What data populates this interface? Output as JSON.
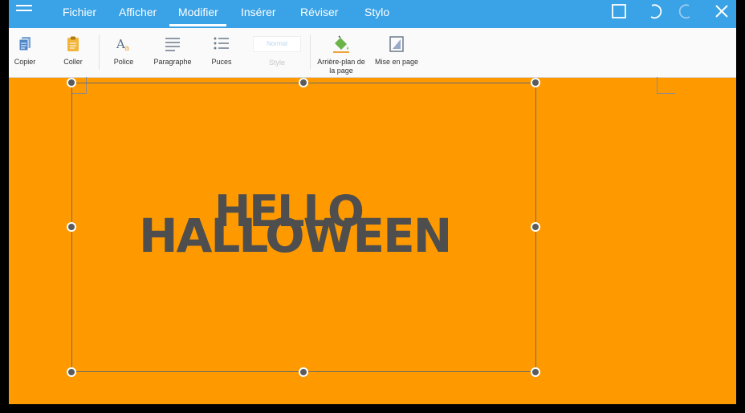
{
  "menu": {
    "tabs": [
      {
        "label": "Fichier"
      },
      {
        "label": "Afficher"
      },
      {
        "label": "Modifier",
        "active": true
      },
      {
        "label": "Insérer"
      },
      {
        "label": "Réviser"
      },
      {
        "label": "Stylo"
      }
    ]
  },
  "ribbon": {
    "copy": "Copier",
    "paste": "Coller",
    "font": "Police",
    "paragraph": "Paragraphe",
    "bullets": "Puces",
    "style_value": "Normal",
    "style": "Style",
    "page_background_line1": "Arrière-plan de",
    "page_background_line2": "la page",
    "page_layout": "Mise en page"
  },
  "canvas": {
    "word_top": "HELLO",
    "word_bottom": "HALLOWEEN",
    "background_color": "#fe9a00",
    "text_color": "#4e4e4e"
  },
  "colors": {
    "menubar": "#3aa2e6",
    "page": "#fe9a00",
    "ribbon": "#fafafa"
  }
}
